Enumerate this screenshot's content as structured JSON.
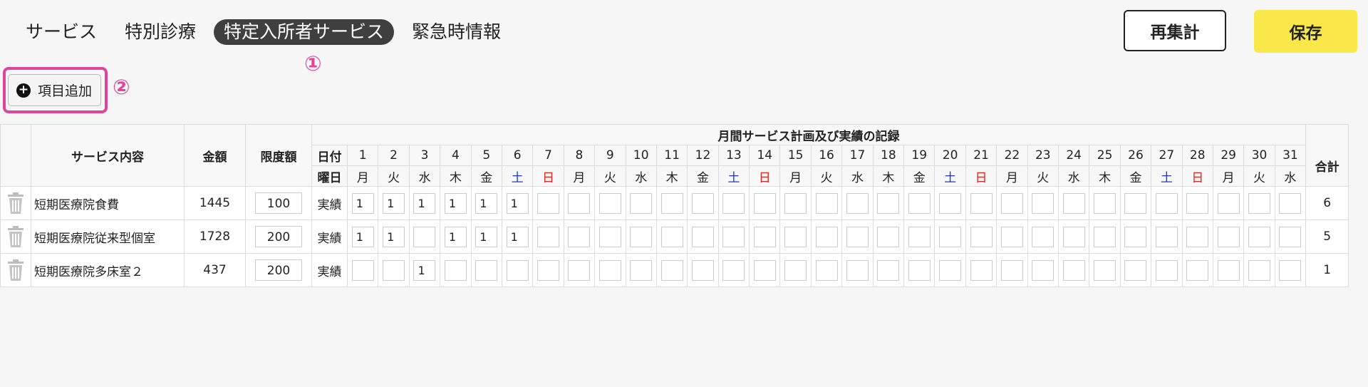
{
  "tabs": [
    {
      "label": "サービス",
      "active": false
    },
    {
      "label": "特別診療",
      "active": false
    },
    {
      "label": "特定入所者サービス",
      "active": true
    },
    {
      "label": "緊急時情報",
      "active": false
    }
  ],
  "markers": {
    "one": "①",
    "two": "②"
  },
  "toolbar": {
    "recalc_label": "再集計",
    "save_label": "保存",
    "add_label": "項目追加"
  },
  "colors": {
    "accent_pink": "#e0449a",
    "save_yellow": "#fae84a",
    "active_tab": "#3f3f3f",
    "saturday": "#2233cc",
    "sunday": "#e2231a"
  },
  "table": {
    "group_header": "月間サービス計画及び実績の記録",
    "col_service": "サービス内容",
    "col_amount": "金額",
    "col_limit": "限度額",
    "col_date": "日付",
    "col_weekday": "曜日",
    "col_total": "合計",
    "days": [
      "1",
      "2",
      "3",
      "4",
      "5",
      "6",
      "7",
      "8",
      "9",
      "10",
      "11",
      "12",
      "13",
      "14",
      "15",
      "16",
      "17",
      "18",
      "19",
      "20",
      "21",
      "22",
      "23",
      "24",
      "25",
      "26",
      "27",
      "28",
      "29",
      "30",
      "31"
    ],
    "weekdays": [
      "月",
      "火",
      "水",
      "木",
      "金",
      "土",
      "日",
      "月",
      "火",
      "水",
      "木",
      "金",
      "土",
      "日",
      "月",
      "火",
      "水",
      "木",
      "金",
      "土",
      "日",
      "月",
      "火",
      "水",
      "木",
      "金",
      "土",
      "日",
      "月",
      "火",
      "水"
    ],
    "rows": [
      {
        "name": "短期医療院食費",
        "amount": "1445",
        "limit": "100",
        "type": "実績",
        "values": [
          "1",
          "1",
          "1",
          "1",
          "1",
          "1",
          "",
          "",
          "",
          "",
          "",
          "",
          "",
          "",
          "",
          "",
          "",
          "",
          "",
          "",
          "",
          "",
          "",
          "",
          "",
          "",
          "",
          "",
          "",
          "",
          ""
        ],
        "total": "6"
      },
      {
        "name": "短期医療院従来型個室",
        "amount": "1728",
        "limit": "200",
        "type": "実績",
        "values": [
          "1",
          "1",
          "",
          "1",
          "1",
          "1",
          "",
          "",
          "",
          "",
          "",
          "",
          "",
          "",
          "",
          "",
          "",
          "",
          "",
          "",
          "",
          "",
          "",
          "",
          "",
          "",
          "",
          "",
          "",
          "",
          ""
        ],
        "total": "5"
      },
      {
        "name": "短期医療院多床室２",
        "amount": "437",
        "limit": "200",
        "type": "実績",
        "values": [
          "",
          "",
          "1",
          "",
          "",
          "",
          "",
          "",
          "",
          "",
          "",
          "",
          "",
          "",
          "",
          "",
          "",
          "",
          "",
          "",
          "",
          "",
          "",
          "",
          "",
          "",
          "",
          "",
          "",
          "",
          ""
        ],
        "total": "1"
      }
    ]
  }
}
